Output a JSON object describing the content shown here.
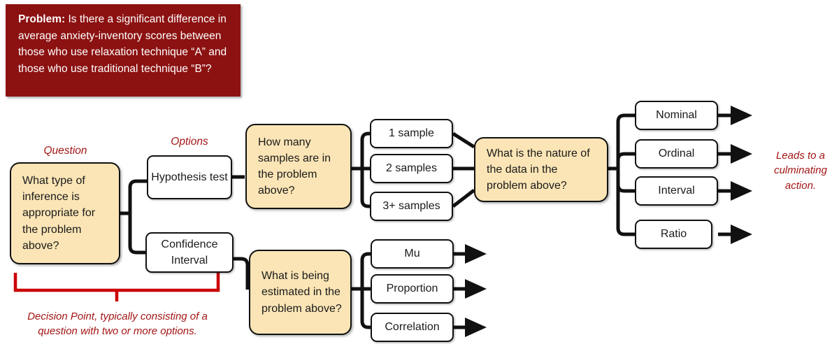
{
  "colors": {
    "banner_bg": "#8C1111",
    "banner_text": "#FFFFFF",
    "decision_fill": "#FBE5B6",
    "option_fill": "#FFFFFF",
    "stroke": "#111111",
    "annotation_red": "#A31515"
  },
  "problem": {
    "label": "Problem:",
    "text": " Is there a significant difference in average anxiety-inventory scores between those who use relaxation technique “A” and those who use traditional technique “B”?"
  },
  "annotations": {
    "question_label": "Question",
    "options_label": "Options",
    "decision_point": "Decision Point, typically consisting of a question with two or more options.",
    "culminating": "Leads to a culminating action."
  },
  "decisions": [
    {
      "id": "inference",
      "text": "What type of inference is appropriate for the problem above?"
    },
    {
      "id": "samples",
      "text": "How many samples are in the problem above?"
    },
    {
      "id": "nature",
      "text": "What is the nature of the data in the problem above?"
    },
    {
      "id": "estimated",
      "text": "What is being estimated in the problem above?"
    }
  ],
  "options": {
    "inference": [
      {
        "id": "hypothesis-test",
        "text": "Hypothesis test"
      },
      {
        "id": "confidence-interval",
        "text": "Confidence Interval"
      }
    ],
    "samples": [
      {
        "id": "one-sample",
        "text": "1 sample"
      },
      {
        "id": "two-samples",
        "text": "2 samples"
      },
      {
        "id": "three-plus-samples",
        "text": "3+ samples"
      }
    ],
    "nature": [
      {
        "id": "nominal",
        "text": "Nominal"
      },
      {
        "id": "ordinal",
        "text": "Ordinal"
      },
      {
        "id": "interval",
        "text": "Interval"
      },
      {
        "id": "ratio",
        "text": "Ratio"
      }
    ],
    "estimated": [
      {
        "id": "mu",
        "text": "Mu"
      },
      {
        "id": "proportion",
        "text": "Proportion"
      },
      {
        "id": "correlation",
        "text": "Correlation"
      }
    ]
  }
}
